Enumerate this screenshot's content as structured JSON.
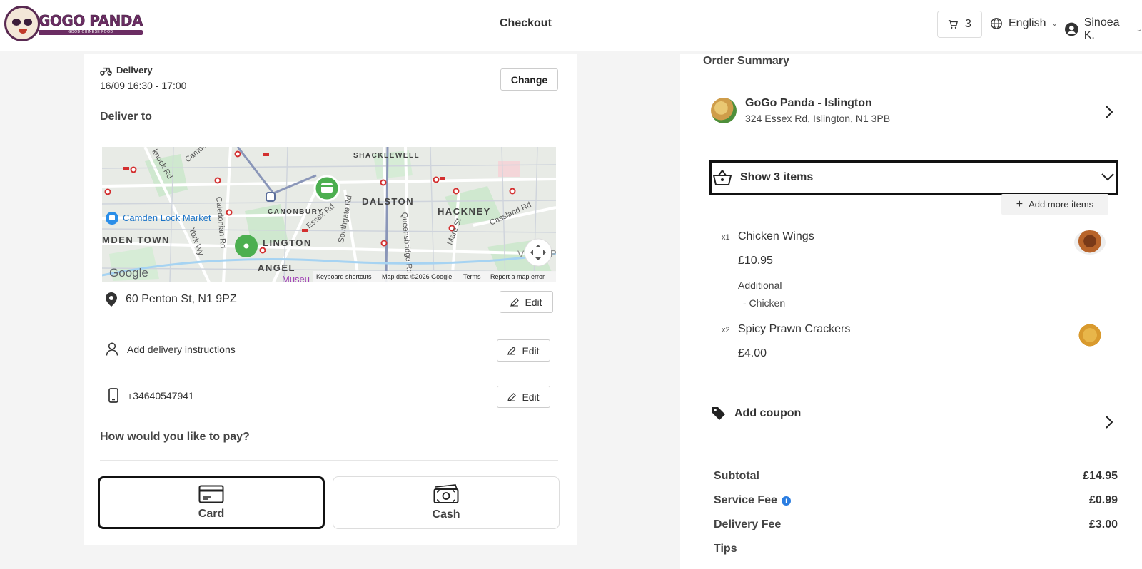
{
  "header": {
    "logo_text": "GOGO PANDA",
    "logo_sub": "GOOD CHINESE FOOD",
    "title": "Checkout",
    "cart_count": "3",
    "language": "English",
    "user_name": "Sinoea K."
  },
  "delivery": {
    "label": "Delivery",
    "time": "16/09 16:30 - 17:00",
    "change_label": "Change",
    "deliver_to_title": "Deliver to"
  },
  "map": {
    "place_labels": [
      "SHACKLEWELL",
      "DALSTON",
      "HACKNEY",
      "CANONBURY",
      "LINGTON",
      "ANGEL",
      "MDEN TOWN"
    ],
    "street_labels": [
      "Camden",
      "Caledonian Rd",
      "York Wy",
      "Essex Rd",
      "Southgate Rd",
      "Queensbridge Rd",
      "Mare St",
      "Cassland Rd",
      "knock Rd"
    ],
    "poi": "Camden Lock Market",
    "museum_fragment": "Museu",
    "vp_fragment": "V",
    "p_fragment": "P",
    "google": "Google",
    "keyboard_shortcuts": "Keyboard shortcuts",
    "map_data": "Map data ©2026 Google",
    "terms": "Terms",
    "report": "Report a map error"
  },
  "address": {
    "street": "60 Penton St, N1 9PZ",
    "instructions": "Add delivery instructions",
    "phone": "+34640547941",
    "edit_label": "Edit"
  },
  "payment": {
    "title": "How would you like to pay?",
    "card_label": "Card",
    "cash_label": "Cash"
  },
  "summary": {
    "title": "Order Summary",
    "restaurant_name": "GoGo Panda - Islington",
    "restaurant_address": "324 Essex Rd, Islington, N1 3PB",
    "show_items_label": "Show 3 items",
    "add_more_label": "Add more items",
    "items": [
      {
        "qty": "x1",
        "name": "Chicken Wings",
        "price": "£10.95",
        "additional_title": "Additional",
        "additional_item": "-  Chicken"
      },
      {
        "qty": "x2",
        "name": "Spicy Prawn Crackers",
        "price": "£4.00"
      }
    ],
    "coupon_label": "Add coupon",
    "subtotal_label": "Subtotal",
    "subtotal_value": "£14.95",
    "service_fee_label": "Service Fee",
    "service_fee_value": "£0.99",
    "delivery_fee_label": "Delivery Fee",
    "delivery_fee_value": "£3.00",
    "tips_label": "Tips"
  },
  "colors": {
    "brand_purple": "#6b2d63",
    "map_pin_green": "#4caf50",
    "info_blue": "#2a7de1"
  }
}
